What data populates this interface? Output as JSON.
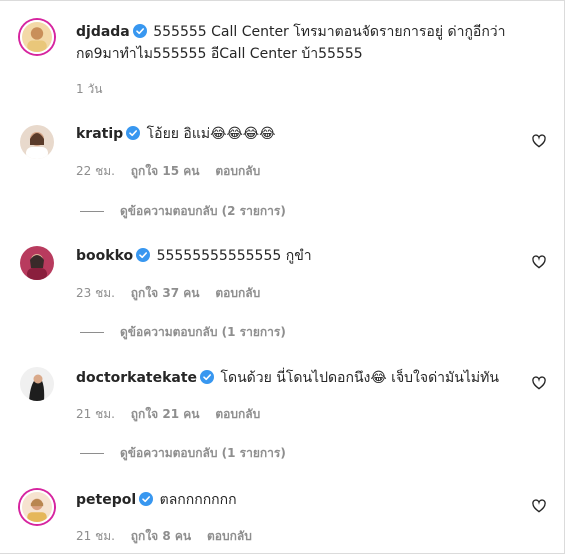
{
  "caption": {
    "username": "djdada",
    "text_line1": "555555 Call Center โทรมาตอนจัดรายการอยู่ ด่ากูอีกว่า",
    "text_line2": "กด9มาทำไม555555 อีCall Center บ้า55555",
    "time": "1 วัน"
  },
  "comments": [
    {
      "username": "kratip",
      "text": "โอ้ยย อิแม่😂😂😂😂",
      "time": "22 ชม.",
      "likes": "ถูกใจ 15 คน",
      "reply_label": "ตอบกลับ",
      "view_replies": "ดูข้อความตอบกลับ (2 รายการ)"
    },
    {
      "username": "bookko",
      "text": "55555555555555 กูขำ",
      "time": "23 ชม.",
      "likes": "ถูกใจ 37 คน",
      "reply_label": "ตอบกลับ",
      "view_replies": "ดูข้อความตอบกลับ (1 รายการ)"
    },
    {
      "username": "doctorkatekate",
      "text": "โดนด้วย นี่โดนไปดอกนึง😂 เจ็บใจด่ามันไม่ทัน",
      "time": "21 ชม.",
      "likes": "ถูกใจ 21 คน",
      "reply_label": "ตอบกลับ",
      "view_replies": "ดูข้อความตอบกลับ (1 รายการ)"
    },
    {
      "username": "petepol",
      "text": "ตลกกกกกกก",
      "time": "21 ชม.",
      "likes": "ถูกใจ 8 คน",
      "reply_label": "ตอบกลับ"
    }
  ],
  "colors": {
    "verified": "#3897f0",
    "text": "#262626",
    "muted": "#8e8e8e"
  },
  "icons": {
    "verified": "verified-badge-icon",
    "like": "heart-outline-icon"
  }
}
